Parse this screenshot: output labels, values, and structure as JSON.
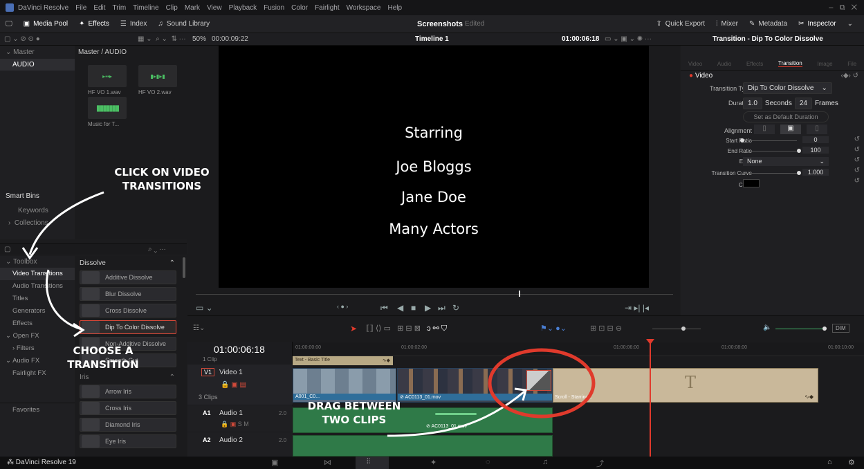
{
  "app": {
    "title": "DaVinci Resolve",
    "menu": [
      "File",
      "Edit",
      "Trim",
      "Timeline",
      "Clip",
      "Mark",
      "View",
      "Playback",
      "Fusion",
      "Color",
      "Fairlight",
      "Workspace",
      "Help"
    ],
    "footer_brand": "DaVinci Resolve 19"
  },
  "pagebar": {
    "media_pool": "Media Pool",
    "effects": "Effects",
    "index": "Index",
    "sound_library": "Sound Library",
    "project_title": "Screenshots",
    "project_state": "Edited",
    "quick_export": "Quick Export",
    "mixer": "Mixer",
    "metadata": "Metadata",
    "inspector": "Inspector"
  },
  "subbar": {
    "zoom": "50%",
    "timecode_left": "00:00:09:22",
    "timeline_name": "Timeline 1",
    "timecode_right": "01:00:06:18",
    "inspector_title": "Transition - Dip To Color Dissolve"
  },
  "media_pool": {
    "master": "Master",
    "bin": "AUDIO",
    "breadcrumb": "Master / AUDIO",
    "clips": [
      "HF VO 1.wav",
      "HF VO 2.wav",
      "Music for T..."
    ],
    "smart_bins": "Smart Bins",
    "keywords": "Keywords",
    "collections": "Collections"
  },
  "effects": {
    "toolbox": "Toolbox",
    "items": [
      "Video Transitions",
      "Audio Transitions",
      "Titles",
      "Generators",
      "Effects"
    ],
    "open_fx": "Open FX",
    "filters": "Filters",
    "audio_fx": "Audio FX",
    "fairlight_fx": "Fairlight FX",
    "favorites": "Favorites",
    "dissolve_header": "Dissolve",
    "dissolve": [
      "Additive Dissolve",
      "Blur Dissolve",
      "Cross Dissolve",
      "Dip To Color Dissolve",
      "Non-Additive Dissolve",
      "Smooth Cut"
    ],
    "iris_header": "Iris",
    "iris": [
      "Arrow Iris",
      "Cross Iris",
      "Diamond Iris",
      "Eye Iris"
    ]
  },
  "viewer": {
    "lines": [
      "Starring",
      "Joe Bloggs",
      "Jane Doe",
      "Many Actors"
    ]
  },
  "inspector": {
    "tabs": [
      "Video",
      "Audio",
      "Effects",
      "Transition",
      "Image",
      "File"
    ],
    "section": "Video",
    "transition_type_label": "Transition Type",
    "transition_type": "Dip To Color Dissolve",
    "duration_label": "Duration",
    "duration_seconds": "1.0",
    "seconds_label": "Seconds",
    "duration_frames": "24",
    "frames_label": "Frames",
    "set_default": "Set as Default Duration",
    "alignment_label": "Alignment",
    "start_ratio_label": "Start Ratio",
    "start_ratio": "0",
    "end_ratio_label": "End Ratio",
    "end_ratio": "100",
    "ease_label": "Ease",
    "ease": "None",
    "curve_label": "Transition Curve",
    "curve": "1.000",
    "color_label": "Color"
  },
  "timeline": {
    "timecode": "01:00:06:18",
    "ruler": [
      "01:00:00:00",
      "01:00:02:00",
      "01:00:06:00",
      "01:00:08:00",
      "01:00:10:00"
    ],
    "track_text": "1 Clip",
    "video_tag": "V1",
    "video_name": "Video 1",
    "video_clips": "3 Clips",
    "title_clip": "Text - Basic Title",
    "clip1": "A001_C0...",
    "clip2": "AC0113_01.mov",
    "scroll_clip": "Scroll - Starring...",
    "audio1_tag": "A1",
    "audio1": "Audio 1",
    "audio1_ch": "2.0",
    "audio2_tag": "A2",
    "audio2": "Audio 2",
    "audio2_ch": "2.0",
    "audio_clip": "AC0113_01.mov",
    "dim": "DIM"
  },
  "annotations": {
    "a1": "CLICK ON VIDEO TRANSITIONS",
    "a2": "CHOOSE A TRANSITION",
    "a3": "DRAG BETWEEN TWO CLIPS"
  },
  "colors": {
    "accent_red": "#e03a2c",
    "clip_blue": "#2f6e9a",
    "audio_green": "#2f7a48",
    "title_tan": "#c9b89a"
  }
}
